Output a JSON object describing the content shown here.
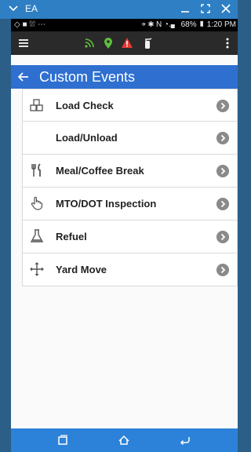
{
  "window": {
    "title": "EA",
    "chevron_icon": "chevron-down-icon",
    "minimize_icon": "minimize-icon",
    "fullscreen_icon": "fullscreen-icon",
    "close_icon": "close-icon"
  },
  "statusbar": {
    "left": "◇ ■ ⛆ ⋯",
    "right": "⌖ ✱ N ◔.▖ 68% ▮ 1:20 PM"
  },
  "toolbar": {
    "menu_icon": "menu-icon",
    "icons": [
      "rss-icon",
      "location-pin-icon",
      "alert-triangle-icon",
      "fire-extinguisher-icon"
    ],
    "overflow_icon": "more-vert-icon",
    "colors": {
      "rss": "#5fbf3f",
      "pin": "#5fbf3f",
      "alert": "#e53935",
      "ext": "#f0f0f0"
    }
  },
  "appbar": {
    "back_icon": "arrow-left-icon",
    "title": "Custom Events",
    "color": "#2e6fd0"
  },
  "events": [
    {
      "label": "Load Check",
      "icon": "boxes-icon"
    },
    {
      "label": "Load/Unload",
      "icon": ""
    },
    {
      "label": "Meal/Coffee Break",
      "icon": "utensils-icon"
    },
    {
      "label": "MTO/DOT Inspection",
      "icon": "hand-pointer-icon"
    },
    {
      "label": "Refuel",
      "icon": "flask-icon"
    },
    {
      "label": "Yard Move",
      "icon": "move-arrows-icon"
    }
  ],
  "navbar": {
    "icons": [
      "recent-apps-icon",
      "home-icon",
      "back-icon"
    ],
    "color": "#2c82d8"
  }
}
